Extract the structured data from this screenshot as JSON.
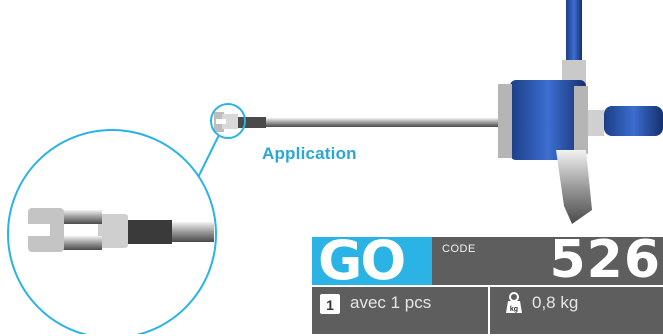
{
  "application_label": "Application",
  "badge": {
    "brand": "GO",
    "code_label": "CODE",
    "code_number": "526"
  },
  "info": {
    "qty_badge": "1",
    "quantity_text": "avec 1 pcs",
    "weight_text": "0,8 kg",
    "weight_icon_letters": "kg"
  },
  "colors": {
    "accent_blue": "#2bb3e6",
    "dark_gray": "#5e5e5e",
    "application_text": "#2aa7d9"
  },
  "icons": [
    "zoom-circle",
    "box-quantity-icon",
    "weight-icon"
  ]
}
